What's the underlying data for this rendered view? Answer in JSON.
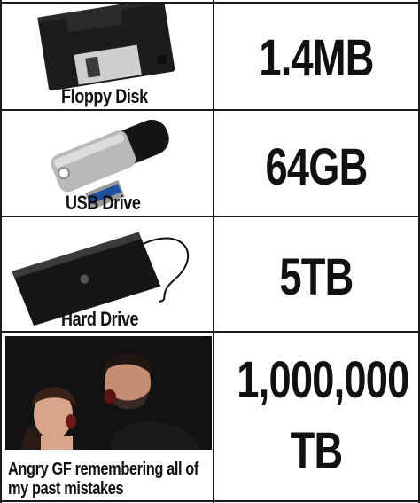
{
  "rows": [
    {
      "label": "Floppy Disk",
      "size": "1.4MB",
      "icon": "floppy-disk-icon"
    },
    {
      "label": "USB Drive",
      "size": "64GB",
      "icon": "usb-drive-icon"
    },
    {
      "label": "Hard Drive",
      "size": "5TB",
      "icon": "hard-drive-icon"
    }
  ],
  "final": {
    "caption_line1": "Angry GF remembering all of",
    "caption_line2": "my past mistakes",
    "size_line1": "1,000,000",
    "size_line2": "TB",
    "image": "couple-shouting-photo"
  },
  "colors": {
    "border": "#1a1a1a",
    "text": "#111111",
    "background": "#ffffff"
  }
}
